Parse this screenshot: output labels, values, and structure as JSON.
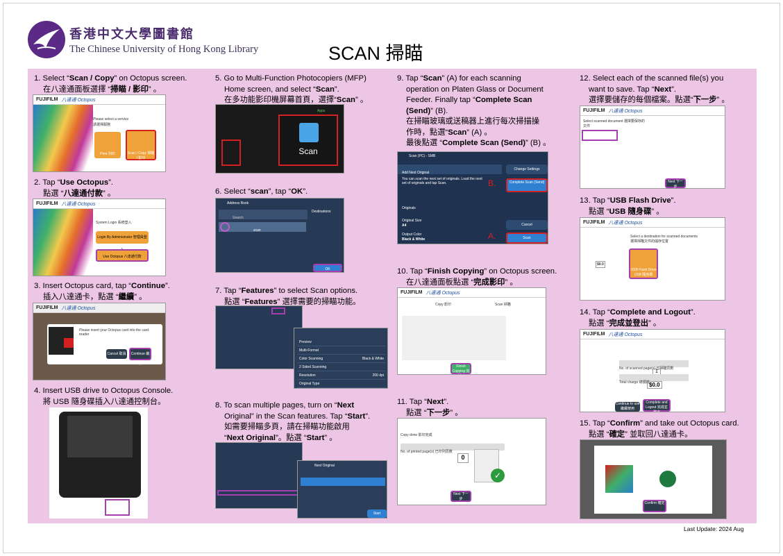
{
  "header": {
    "logo_zh": "香港中文大學圖書館",
    "logo_en": "The Chinese University of Hong Kong Library",
    "title": "SCAN 掃瞄"
  },
  "steps": [
    {
      "id": 1,
      "lines": [
        "1. Select “<b>Scan / Copy</b>” on Octopus screen.",
        "在八達通面板選擇 “<b>掃瞄 / 影印</b>” 。"
      ]
    },
    {
      "id": 2,
      "lines": [
        "2. Tap “<b>Use Octopus</b>”.",
        "點選 “<b>八達通付款</b>” 。"
      ]
    },
    {
      "id": 3,
      "lines": [
        "3.  Insert Octopus card, tap “<b>Continue</b>”.",
        "插入八達通卡，點選 “<b>繼續</b>” 。"
      ]
    },
    {
      "id": 4,
      "lines": [
        "4. Insert USB drive to Octopus Console.",
        "將 USB 隨身碟插入八達通控制台。"
      ]
    },
    {
      "id": 5,
      "lines": [
        "5. Go to Multi-Function Photocopiers (MFP)",
        "Home screen, and select “<b>Scan</b>”.",
        "在多功能影印機屏幕首頁，選擇“<b>Scan</b>” 。"
      ]
    },
    {
      "id": 6,
      "lines": [
        "6. Select “<b>scan</b>”, tap “<b>OK</b>”."
      ]
    },
    {
      "id": 7,
      "lines": [
        "7.  Tap “<b>Features</b>” to select Scan options.",
        "點選 “<b>Features</b>” 選擇需要的掃瞄功能。"
      ]
    },
    {
      "id": 8,
      "lines": [
        "8. To scan multiple pages, turn on “<b>Next</b>",
        "Original” in the Scan features. Tap “<b>Start</b>”.",
        "如需要掃瞄多頁，請在掃瞄功能啟用",
        "“<b>Next Original</b>”。點選 “<b>Start</b>” 。"
      ]
    },
    {
      "id": 9,
      "lines": [
        "9.  Tap “<b>Scan</b>” (A) for each scanning",
        "operation on Platen Glass or Document",
        "Feeder. Finally tap “<b>Complete Scan</b>",
        "<b>(Send)</b>” (B).",
        "在掃瞄玻璃或送稿器上進行每次掃描操",
        "作時，點選“<b>Scan</b>” (A) 。",
        "最後點選 “<b>Complete Scan (Send)</b>” (B) 。"
      ]
    },
    {
      "id": 10,
      "lines": [
        "10. Tap “<b>Finish Copying</b>” on Octopus screen.",
        "在八達通面板點選 “<b>完成影印</b>” 。"
      ]
    },
    {
      "id": 11,
      "lines": [
        "11. Tap “<b>Next</b>”.",
        "點選 “<b>下一步</b>” 。"
      ]
    },
    {
      "id": 12,
      "lines": [
        "12. Select each of the scanned file(s) you",
        "want to save. Tap “<b>Next</b>”.",
        "選擇要儲存的每個檔案。點選“<b>下一步</b>” 。"
      ]
    },
    {
      "id": 13,
      "lines": [
        "13. Tap “<b>USB Flash Drive</b>”.",
        "點選 “<b>USB 隨身碟</b>” 。"
      ]
    },
    {
      "id": 14,
      "lines": [
        "14. Tap “<b>Complete and Logout</b>”.",
        "點選 “<b>完成並登出</b>” 。"
      ]
    },
    {
      "id": 15,
      "lines": [
        "15. Tap “<b>Confirm</b>” and take out Octopus card.",
        "點選 “<b>確定</b>” 並取回八達通卡。"
      ]
    }
  ],
  "screens": {
    "fujifilm": "FUJIFILM",
    "octopus": "八達通 Octopus",
    "s1": {
      "prompt": "Please select a service",
      "prompt_zh": "請選擇服務",
      "print": "Print 列印",
      "scan": "Scan / Copy 掃瞄 / 影印"
    },
    "s2": {
      "login": "System Login 系統登入",
      "admin": "Login By Administrator 管理員登入",
      "octopus": "Use Octopus 八達通付款"
    },
    "s3": {
      "msg": "Please insert your Octopus card into the card reader",
      "cancel": "Cancel 取消",
      "continue": "Continue 繼續"
    },
    "s5": {
      "apps": "Apps",
      "scan": "Scan"
    },
    "s6": {
      "address_book": "Address Book",
      "search": "Search",
      "destinations": "Destinations",
      "scan": "scan",
      "ok": "OK"
    },
    "s7": {
      "items": [
        "Preview",
        "Multi-Format",
        "Color Scanning",
        "2 Sided Scanning",
        "Resolution",
        "Original Type"
      ],
      "values": [
        "",
        "",
        "Black & White",
        "",
        "200 dpi",
        ""
      ]
    },
    "s8": {
      "next_original": "Next Original",
      "start": "Start"
    },
    "s9": {
      "title": "Scan (PC) - SMB",
      "add_next": "Add Next Original",
      "change_settings": "Change Settings",
      "msg": "You can scan the next set of originals. Load the next set of originals and tap Scan.",
      "transfer": "Transfer Destination",
      "complete": "Complete Scan (Send)",
      "originals": "Originals",
      "size": "Original Size",
      "a4": "A4",
      "output": "Output Color",
      "bw": "Black & White",
      "cancel": "Cancel",
      "scan": "Scan",
      "b": "B.",
      "a": "A."
    },
    "s10": {
      "copy": "Copy 影印",
      "scan": "Scan 掃瞄",
      "finish": "Finish Copying 完成影印"
    },
    "s11": {
      "copy_done": "Copy done 影印完成",
      "printed": "No. of printed page(s) 已印列頁數",
      "value": "0",
      "next": "Next 下一步"
    },
    "s12": {
      "select": "Select scanned document 選擇要保存的文件",
      "next": "Next 下一步"
    },
    "s13": {
      "prompt": "Select a destination for scanned documents 選擇掃瞄文件的儲存位置",
      "usb": "USB Flash Drive USB 隨身碟",
      "price": "$0.0"
    },
    "s14": {
      "scanned": "No. of scanned page(s) 已掃瞄頁數",
      "total": "Total charge 總價錢",
      "total_value": "$0.0",
      "continue": "Continue to use 繼續使用",
      "complete": "Complete and Logout 完成並登出",
      "one": "1"
    },
    "s15": {
      "confirm": "Confirm 確定"
    }
  },
  "footer": "Last Update: 2024 Aug"
}
